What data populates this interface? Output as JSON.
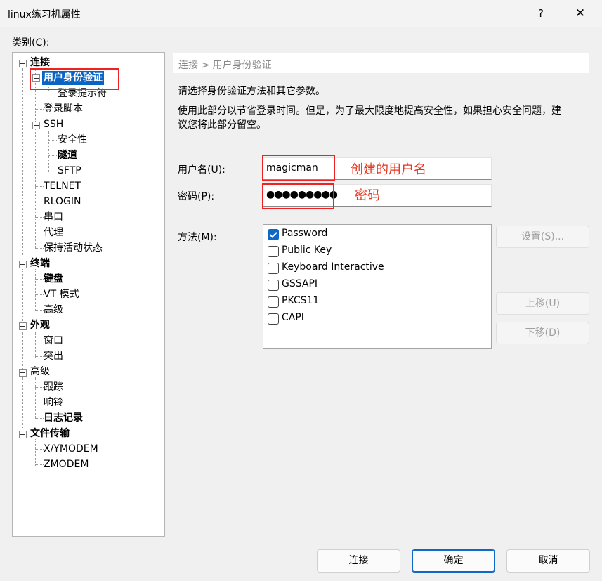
{
  "window": {
    "title": "linux练习机属性",
    "help": "?",
    "close": "✕"
  },
  "category_label": "类别(C):",
  "tree": [
    "连接",
    "用户身份验证",
    "登录提示符",
    "登录脚本",
    "SSH",
    "安全性",
    "隧道",
    "SFTP",
    "TELNET",
    "RLOGIN",
    "串口",
    "代理",
    "保持活动状态",
    "终端",
    "键盘",
    "VT 模式",
    "高级",
    "外观",
    "窗口",
    "突出",
    "高级",
    "跟踪",
    "响铃",
    "日志记录",
    "文件传输",
    "X/YMODEM",
    "ZMODEM"
  ],
  "breadcrumb": "连接 > 用户身份验证",
  "description1": "请选择身份验证方法和其它参数。",
  "description2_line1": "使用此部分以节省登录时间。但是，为了最大限度地提高安全性，如果担心安全问题，建",
  "description2_line2": "议您将此部分留空。",
  "username": {
    "label": "用户名(U):",
    "value": "magicman",
    "annotation": "创建的用户名"
  },
  "password": {
    "label": "密码(P):",
    "value": "●●●●●●●●●",
    "annotation": "密码"
  },
  "method": {
    "label": "方法(M):",
    "options": [
      {
        "label": "Password",
        "checked": true
      },
      {
        "label": "Public Key",
        "checked": false
      },
      {
        "label": "Keyboard Interactive",
        "checked": false
      },
      {
        "label": "GSSAPI",
        "checked": false
      },
      {
        "label": "PKCS11",
        "checked": false
      },
      {
        "label": "CAPI",
        "checked": false
      }
    ]
  },
  "buttons": {
    "settings": "设置(S)...",
    "move_up": "上移(U)",
    "move_down": "下移(D)"
  },
  "footer": {
    "connect": "连接",
    "ok": "确定",
    "cancel": "取消"
  }
}
